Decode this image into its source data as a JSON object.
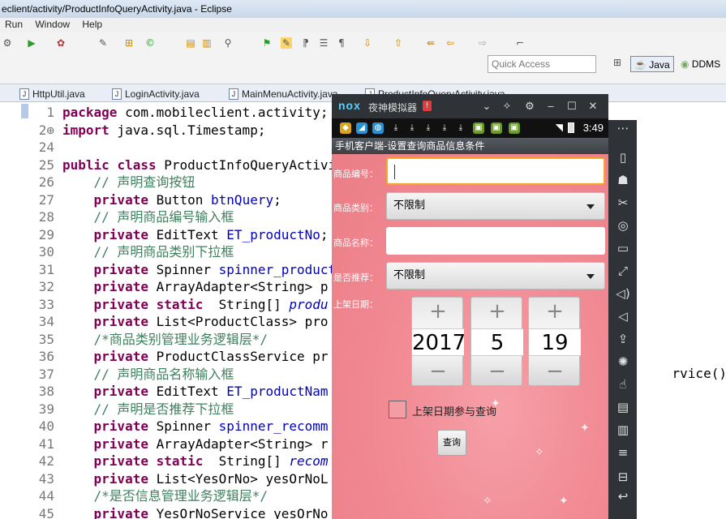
{
  "window_title": "eclient/activity/ProductInfoQueryActivity.java - Eclipse",
  "menu": [
    "Run",
    "Window",
    "Help"
  ],
  "quick_access_placeholder": "Quick Access",
  "perspectives": [
    "Java",
    "DDMS"
  ],
  "tabs": [
    "HttpUtil.java",
    "LoginActivity.java",
    "MainMenuActivity.java",
    "ProductInfoQueryActivity.java"
  ],
  "code": [
    {
      "n": "1",
      "t": "package com.mobileclient.activity;"
    },
    {
      "n": "2⊕",
      "t": "import java.sql.Timestamp;"
    },
    {
      "n": "24",
      "t": ""
    },
    {
      "n": "25",
      "t": "public class ProductInfoQueryActivity"
    },
    {
      "n": "26",
      "t": "    // 声明查询按钮"
    },
    {
      "n": "27",
      "t": "    private Button btnQuery;"
    },
    {
      "n": "28",
      "t": "    // 声明商品编号输入框"
    },
    {
      "n": "29",
      "t": "    private EditText ET_productNo;"
    },
    {
      "n": "30",
      "t": "    // 声明商品类别下拉框"
    },
    {
      "n": "31",
      "t": "    private Spinner spinner_product"
    },
    {
      "n": "32",
      "t": "    private ArrayAdapter<String> p"
    },
    {
      "n": "33",
      "t": "    private static  String[] produ"
    },
    {
      "n": "34",
      "t": "    private List<ProductClass> pro"
    },
    {
      "n": "35",
      "t": "    /*商品类别管理业务逻辑层*/"
    },
    {
      "n": "36",
      "t": "    private ProductClassService pr"
    },
    {
      "n": "37",
      "t": "    // 声明商品名称输入框"
    },
    {
      "n": "38",
      "t": "    private EditText ET_productNam"
    },
    {
      "n": "39",
      "t": "    // 声明是否推荐下拉框"
    },
    {
      "n": "40",
      "t": "    private Spinner spinner_recomm"
    },
    {
      "n": "41",
      "t": "    private ArrayAdapter<String> r"
    },
    {
      "n": "42",
      "t": "    private static  String[] recom"
    },
    {
      "n": "43",
      "t": "    private List<YesOrNo> yesOrNoL"
    },
    {
      "n": "44",
      "t": "    /*是否信息管理业务逻辑层*/"
    },
    {
      "n": "45",
      "t": "    private YesOrNoService yesOrNo"
    }
  ],
  "code_overflow_36": "rvice();",
  "emulator": {
    "logo": "nox",
    "name": "夜神模拟器",
    "badge": "!",
    "clock": "3:49",
    "app_title": "手机客户端-设置查询商品信息条件",
    "label_product_no": "商品编号：",
    "label_product_class": "商品类别：",
    "product_class_value": "不限制",
    "label_product_name": "商品名称：",
    "label_recommend": "是否推荐：",
    "recommend_value": "不限制",
    "label_date": "上架日期：",
    "year": "2017",
    "month": "5",
    "day": "19",
    "checkbox_label": "上架日期参与查询",
    "query_button": "查询"
  }
}
